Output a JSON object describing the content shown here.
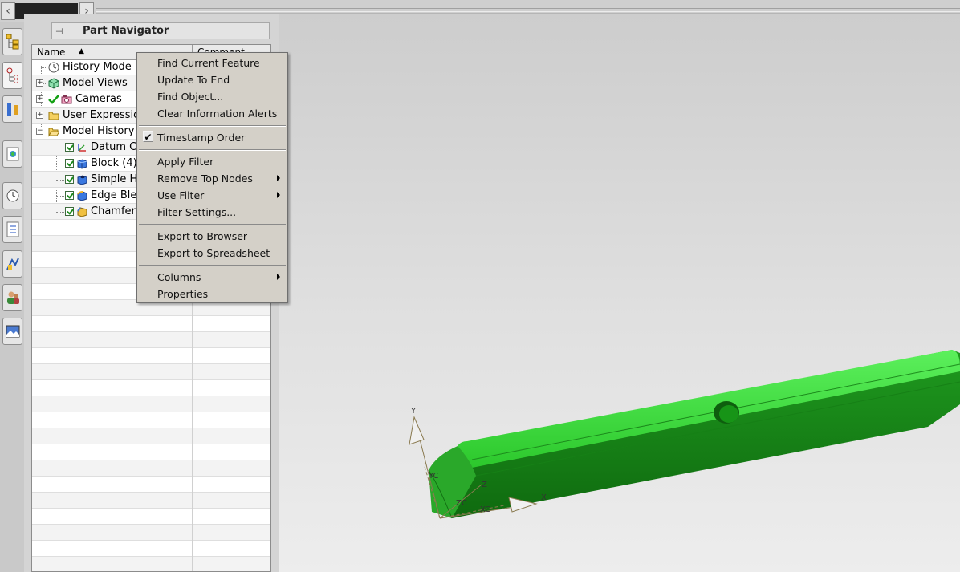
{
  "navigator": {
    "title": "Part Navigator",
    "columns": {
      "name": "Name",
      "comment": "Comment"
    },
    "nodes": [
      {
        "label": "History Mode",
        "icon": "clock-icon"
      },
      {
        "label": "Model Views",
        "icon": "model-views-icon"
      },
      {
        "label": "Cameras",
        "icon": "camera-icon"
      },
      {
        "label": "User Expressions",
        "icon": "folder-icon"
      },
      {
        "label": "Model History",
        "icon": "folder-open-icon"
      },
      {
        "label": "Datum Coordinate System",
        "icon": "datum-csys-icon"
      },
      {
        "label": "Block (4)",
        "icon": "block-icon"
      },
      {
        "label": "Simple Hole",
        "icon": "hole-icon"
      },
      {
        "label": "Edge Blend",
        "icon": "edge-blend-icon"
      },
      {
        "label": "Chamfer",
        "icon": "chamfer-icon"
      }
    ]
  },
  "context_menu": {
    "groups": [
      [
        "Find Current Feature",
        "Update To End",
        "Find Object...",
        "Clear Information Alerts"
      ],
      [
        "Timestamp Order"
      ],
      [
        "Apply Filter",
        "Remove Top Nodes",
        "Use Filter",
        "Filter Settings..."
      ],
      [
        "Export to Browser",
        "Export to Spreadsheet"
      ],
      [
        "Columns",
        "Properties"
      ]
    ],
    "checked": "Timestamp Order",
    "submenus": [
      "Remove Top Nodes",
      "Use Filter",
      "Columns"
    ]
  },
  "viewport": {
    "triad_labels": {
      "y": "Y",
      "yc": "YC",
      "z": "Z",
      "zc": "ZC",
      "xc": "XC",
      "x": "X"
    },
    "part_color": "#3fd83f"
  },
  "colors": {
    "menu_bg": "#d4d0c8",
    "viewport_bg": "#e0e0e0",
    "part": "#3fd83f"
  }
}
